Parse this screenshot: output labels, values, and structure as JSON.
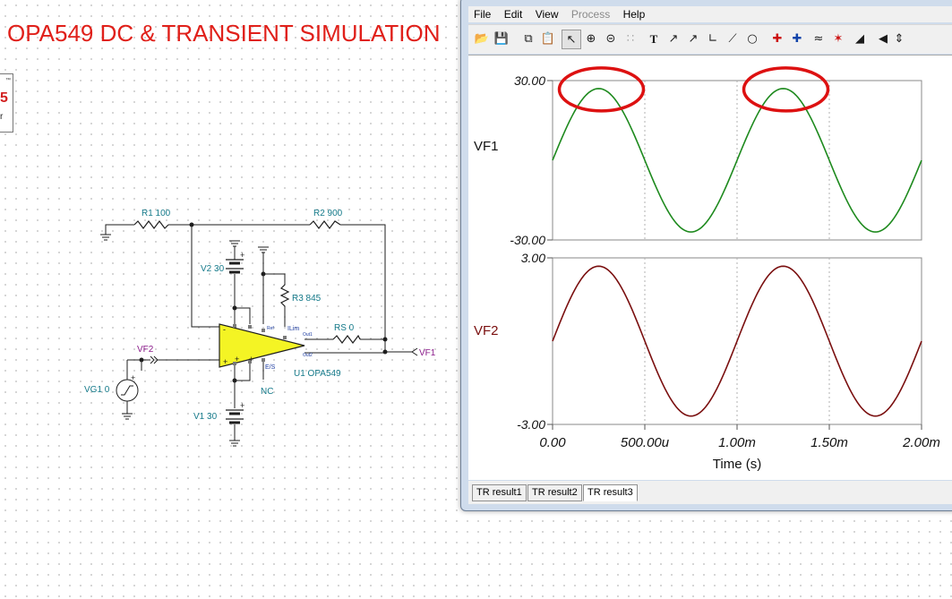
{
  "title": "OPA549 DC & TRANSIENT SIMULATION",
  "schematic": {
    "labels": {
      "r1": "R1 100",
      "r2": "R2 900",
      "v2": "V2 30",
      "r3": "R3 845",
      "rs": "RS 0",
      "vf2": "VF2",
      "vf1": "VF1",
      "vg1": "VG1 0",
      "v1": "V1 30",
      "u1": "U1 OPA549",
      "nc": "NC",
      "pin_ilim": "ILim",
      "pin_es": "E/S",
      "pin_ref": "Ref",
      "pin_out1": "Out1",
      "pin_out2": "Out2"
    }
  },
  "window": {
    "menu": [
      "File",
      "Edit",
      "View",
      "Process",
      "Help"
    ],
    "menu_disabled": [
      "Process"
    ],
    "toolbar_icons": [
      "open-folder-icon",
      "save-icon",
      "copy-icon",
      "paste-icon",
      "pointer-icon",
      "zoom-in-icon",
      "zoom-100-icon",
      "grid-icon",
      "text-icon",
      "curve-label-icon",
      "curve-label-2-icon",
      "axis-icon",
      "line-icon",
      "circle-icon",
      "cursor-a-icon",
      "cursor-b-icon",
      "waveform-icon",
      "marker-icon",
      "flag-icon",
      "scroll-left-icon",
      "scroll-updown-icon"
    ],
    "tabs": [
      "TR result1",
      "TR result2",
      "TR result3"
    ],
    "active_tab": "TR result3"
  },
  "chart_data": [
    {
      "type": "line",
      "series": [
        {
          "name": "VF1",
          "color": "#1e8a1e",
          "shape": "sine",
          "amplitude": 27,
          "frequency_hz": 1000,
          "t_start": 0,
          "t_end": 0.002,
          "start_value": 0
        }
      ],
      "ylabel": "VF1",
      "ylim": [
        -30,
        30
      ],
      "ytick_labels": [
        "30.00",
        "-30.00"
      ],
      "grid": true,
      "annotations": [
        {
          "type": "circle",
          "color": "#dd1111",
          "target": "first-peak"
        },
        {
          "type": "circle",
          "color": "#dd1111",
          "target": "second-peak"
        }
      ]
    },
    {
      "type": "line",
      "series": [
        {
          "name": "VF2",
          "color": "#7a0f0f",
          "shape": "sine",
          "amplitude": 2.7,
          "frequency_hz": 1000,
          "t_start": 0,
          "t_end": 0.002,
          "start_value": 0
        }
      ],
      "ylabel": "VF2",
      "ylim": [
        -3,
        3
      ],
      "ytick_labels": [
        "3.00",
        "-3.00"
      ],
      "xlim": [
        0,
        0.002
      ],
      "xtick_labels": [
        "0.00",
        "500.00u",
        "1.00m",
        "1.50m",
        "2.00m"
      ],
      "xlabel": "Time (s)",
      "grid": true
    }
  ]
}
